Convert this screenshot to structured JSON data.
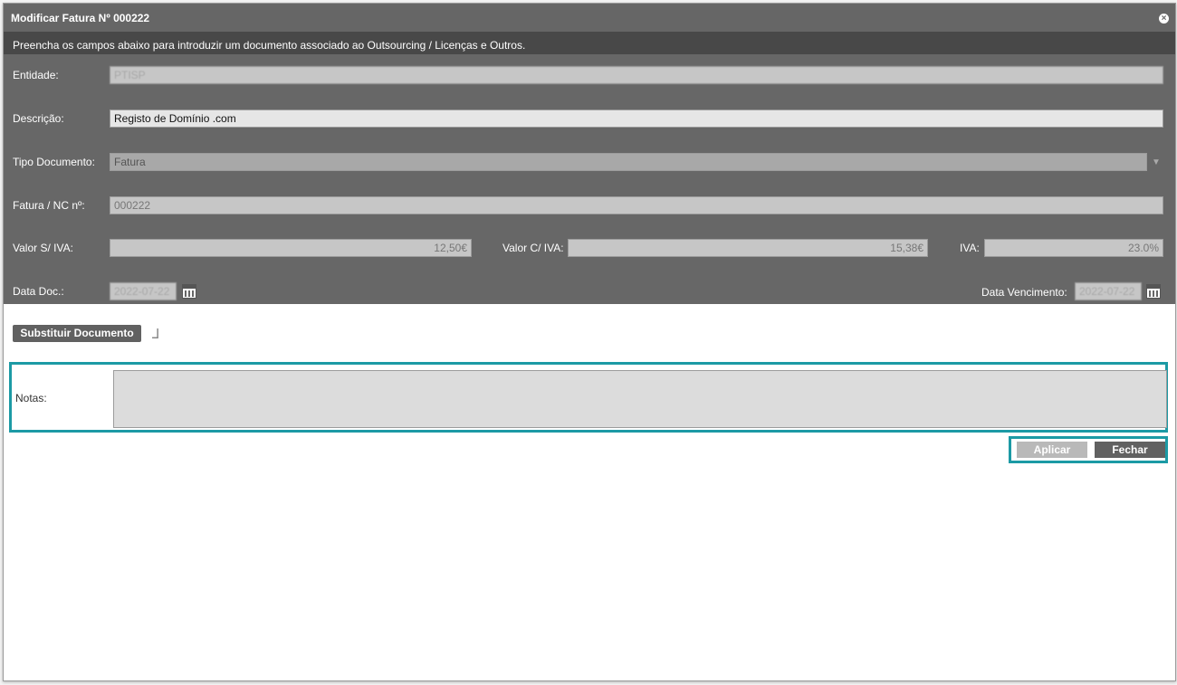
{
  "dialog": {
    "title": "Modificar Fatura Nº 000222",
    "subtitle": "Preencha os campos abaixo para introduzir um documento associado ao Outsourcing / Licenças e Outros."
  },
  "form": {
    "entidade": {
      "label": "Entidade:",
      "value": "PTISP"
    },
    "descricao": {
      "label": "Descrição:",
      "value": "Registo de Domínio .com"
    },
    "tipo_documento": {
      "label": "Tipo Documento:",
      "value": "Fatura"
    },
    "fatura_nc": {
      "label": "Fatura / NC nº:",
      "value": "000222"
    },
    "valor_sem_iva": {
      "label": "Valor S/ IVA:",
      "value": "12,50€"
    },
    "valor_com_iva": {
      "label": "Valor C/ IVA:",
      "value": "15,38€"
    },
    "iva": {
      "label": "IVA:",
      "value": "23.0%"
    },
    "data_doc": {
      "label": "Data Doc.:",
      "value": "2022-07-22"
    },
    "data_vencimento": {
      "label": "Data Vencimento:",
      "value": "2022-07-22"
    }
  },
  "actions": {
    "replace_document": "Substituir Documento",
    "apply": "Aplicar",
    "close": "Fechar"
  },
  "notes": {
    "label": "Notas:",
    "value": ""
  }
}
